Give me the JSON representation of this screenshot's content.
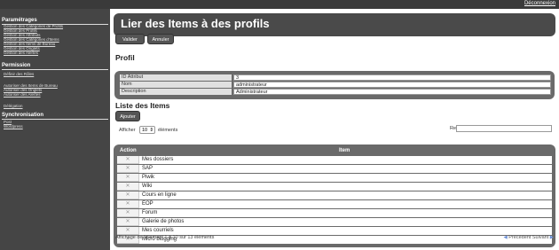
{
  "topbar": {
    "logout_label": "Déconnexion"
  },
  "sidebar": {
    "sections": [
      {
        "title": "Paramétrages",
        "items": [
          "Gestion des Catégories de Profils",
          "Gestion des Profils",
          "Gestion des Attributs",
          "Gestion des Catégories d'Items",
          "Gestion des Items de Bureau",
          "Gestion des Onglets",
          "Gestion des Alertes"
        ]
      },
      {
        "title": "Permission",
        "items": [
          "Définir des Rôles",
          "",
          "Autoriser des Items de Bureau",
          "Autoriser des Onglets",
          "Autoriser des Alertes",
          "",
          "Délégation"
        ]
      },
      {
        "title": "Synchronisation",
        "items": [
          "Post",
          "Wordpress"
        ]
      }
    ]
  },
  "main": {
    "title": "Lier des Items à des profils",
    "buttons": {
      "validate": "Valider",
      "cancel": "Annuler",
      "add": "Ajouter"
    },
    "profile": {
      "heading": "Profil",
      "rows": [
        {
          "label": "ID Attribut",
          "value": "3"
        },
        {
          "label": "Nom",
          "value": "administrateur"
        },
        {
          "label": "Description",
          "value": "Administrateur"
        }
      ]
    },
    "items_list": {
      "heading": "Liste des Items",
      "show_prefix": "Afficher",
      "page_size": "10",
      "show_suffix": "éléments",
      "search_label": "Rechercher :",
      "col_action": "Action",
      "col_item": "Item",
      "rows": [
        "Mes dossiers",
        "SAP",
        "Piwik",
        "Wiki",
        "Cours en ligne",
        "EOP",
        "Forum",
        "Galerie de photos",
        "Mes courriels",
        "Micro blogging"
      ],
      "info": "Affichage de l'élément 1 à 10 sur 13 éléments",
      "prev": "Précédent",
      "next": "Suivant"
    }
  }
}
